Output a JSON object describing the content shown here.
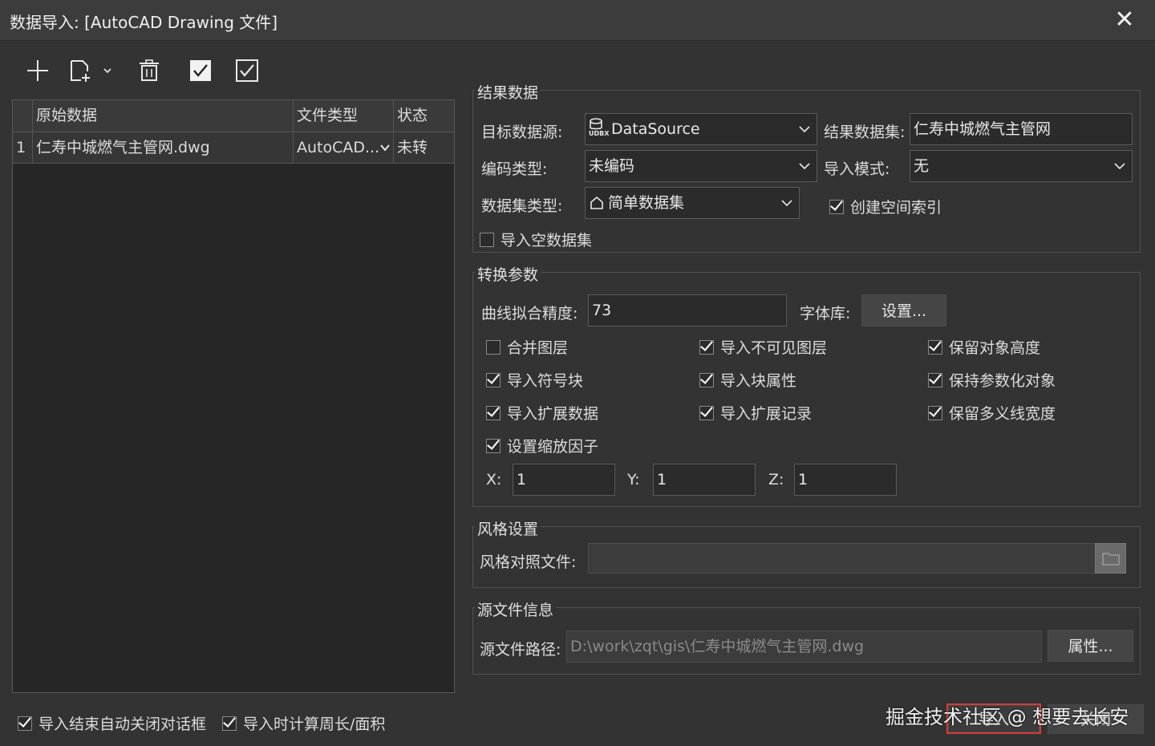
{
  "window": {
    "title": "数据导入: [AutoCAD Drawing 文件]",
    "close_glyph": "✕"
  },
  "grid": {
    "columns": [
      "原始数据",
      "文件类型",
      "状态"
    ],
    "rows": [
      {
        "index": "1",
        "name": "仁寿中城燃气主管网.dwg",
        "type": "AutoCAD...",
        "status": "未转"
      }
    ]
  },
  "result": {
    "group_title": "结果数据",
    "target_source_label": "目标数据源:",
    "target_source_value": "DataSource",
    "target_source_icon_text": "UDBX",
    "dataset_label": "结果数据集:",
    "dataset_value": "仁寿中城燃气主管网",
    "encoding_label": "编码类型:",
    "encoding_value": "未编码",
    "import_mode_label": "导入模式:",
    "import_mode_value": "无",
    "dataset_type_label": "数据集类型:",
    "dataset_type_value": "简单数据集",
    "spatial_index_label": "创建空间索引",
    "spatial_index_checked": true,
    "import_empty_label": "导入空数据集",
    "import_empty_checked": false
  },
  "convert": {
    "group_title": "转换参数",
    "curve_label": "曲线拟合精度:",
    "curve_value": "73",
    "font_label": "字体库:",
    "font_button": "设置...",
    "options": [
      {
        "label": "合并图层",
        "checked": false
      },
      {
        "label": "导入不可见图层",
        "checked": true
      },
      {
        "label": "保留对象高度",
        "checked": true
      },
      {
        "label": "导入符号块",
        "checked": true
      },
      {
        "label": "导入块属性",
        "checked": true
      },
      {
        "label": "保持参数化对象",
        "checked": true
      },
      {
        "label": "导入扩展数据",
        "checked": true
      },
      {
        "label": "导入扩展记录",
        "checked": true
      },
      {
        "label": "保留多义线宽度",
        "checked": true
      },
      {
        "label": "设置缩放因子",
        "checked": true
      }
    ],
    "x_label": "X:",
    "x_value": "1",
    "y_label": "Y:",
    "y_value": "1",
    "z_label": "Z:",
    "z_value": "1"
  },
  "style": {
    "group_title": "风格设置",
    "file_label": "风格对照文件:",
    "file_value": ""
  },
  "source": {
    "group_title": "源文件信息",
    "path_label": "源文件路径:",
    "path_value": "D:\\work\\zqt\\gis\\仁寿中城燃气主管网.dwg",
    "props_button": "属性..."
  },
  "footer": {
    "auto_close_label": "导入结束自动关闭对话框",
    "auto_close_checked": true,
    "calc_label": "导入时计算周长/面积",
    "calc_checked": true,
    "import_button": "导入",
    "close_button": "关闭",
    "watermark": "掘金技术社区 @ 想要去长安"
  }
}
